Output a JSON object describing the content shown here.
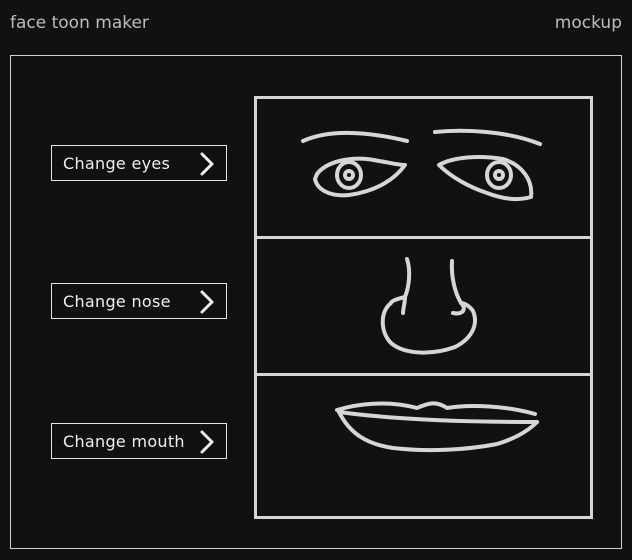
{
  "app": {
    "title": "face toon maker",
    "mode_label": "mockup"
  },
  "controls": {
    "buttons": [
      {
        "label": "Change eyes",
        "icon": "chevron-right-icon"
      },
      {
        "label": "Change nose",
        "icon": "chevron-right-icon"
      },
      {
        "label": "Change mouth",
        "icon": "chevron-right-icon"
      }
    ]
  },
  "face": {
    "parts": [
      "eyes",
      "nose",
      "mouth"
    ]
  },
  "colors": {
    "background": "#111111",
    "stroke": "#d6d6d6",
    "text": "#bdbdbd"
  }
}
